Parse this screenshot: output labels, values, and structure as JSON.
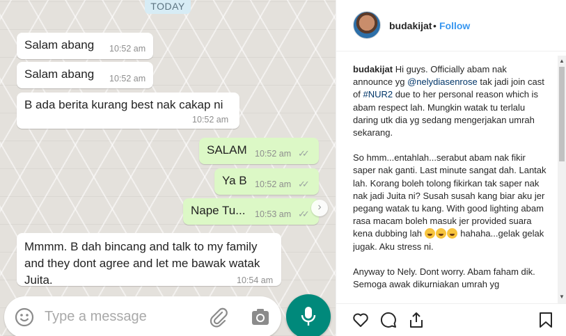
{
  "chat": {
    "date_chip": "TODAY",
    "messages": [
      {
        "text": "Salam abang",
        "time": "10:52 am",
        "direction": "in"
      },
      {
        "text": "Salam abang",
        "time": "10:52 am",
        "direction": "in"
      },
      {
        "text": "B ada berita kurang best nak cakap ni",
        "time": "10:52 am",
        "direction": "in"
      },
      {
        "text": "SALAM",
        "time": "10:52 am",
        "direction": "out",
        "ticks": "✓✓"
      },
      {
        "text": "Ya B",
        "time": "10:52 am",
        "direction": "out",
        "ticks": "✓✓"
      },
      {
        "text": "Nape Tu...",
        "time": "10:53 am",
        "direction": "out",
        "ticks": "✓✓"
      },
      {
        "text": "Mmmm. B dah bincang and talk to my family\nand they dont agree and let me bawak watak\nJuita.",
        "time": "10:54 am",
        "direction": "in"
      }
    ],
    "input_placeholder": "Type a message",
    "colors": {
      "outgoing": "#dcf8c6",
      "incoming": "#ffffff",
      "mic": "#00897b"
    },
    "icons": [
      "emoji-icon",
      "paperclip-icon",
      "camera-icon",
      "mic-icon",
      "chevron-right-icon"
    ]
  },
  "instagram": {
    "username": "budakijat",
    "separator": "•",
    "follow_label": "Follow",
    "caption": {
      "p1_user": "budakijat",
      "p1_a": " Hi guys. Officially abam nak announce yg ",
      "p1_mention": "@nelydiasenrose",
      "p1_b": " tak jadi join cast of ",
      "p1_hashtag": "#NUR2",
      "p1_c": " due to her personal reason which is abam respect lah. Mungkin watak tu terlalu daring utk dia yg sedang mengerjakan umrah sekarang.",
      "p2_a": "So hmm...entahlah...serabut abam nak fikir saper nak ganti. Last minute sangat dah. Lantak lah. Korang boleh tolong fikirkan tak saper nak nak jadi Juita ni? Susah susah kang biar aku jer pegang watak tu kang. With good lighting abam rasa macam boleh masuk jer provided suara kena dubbing lah ",
      "p2_b": " hahaha...gelak gelak jugak. Aku stress ni.",
      "p3": "Anyway to Nely. Dont worry. Abam faham dik. Semoga awak dikurniakan umrah yg"
    },
    "colors": {
      "link": "#003569",
      "follow": "#3897f0"
    },
    "icons": [
      "heart-icon",
      "comment-icon",
      "share-icon",
      "bookmark-icon"
    ]
  }
}
